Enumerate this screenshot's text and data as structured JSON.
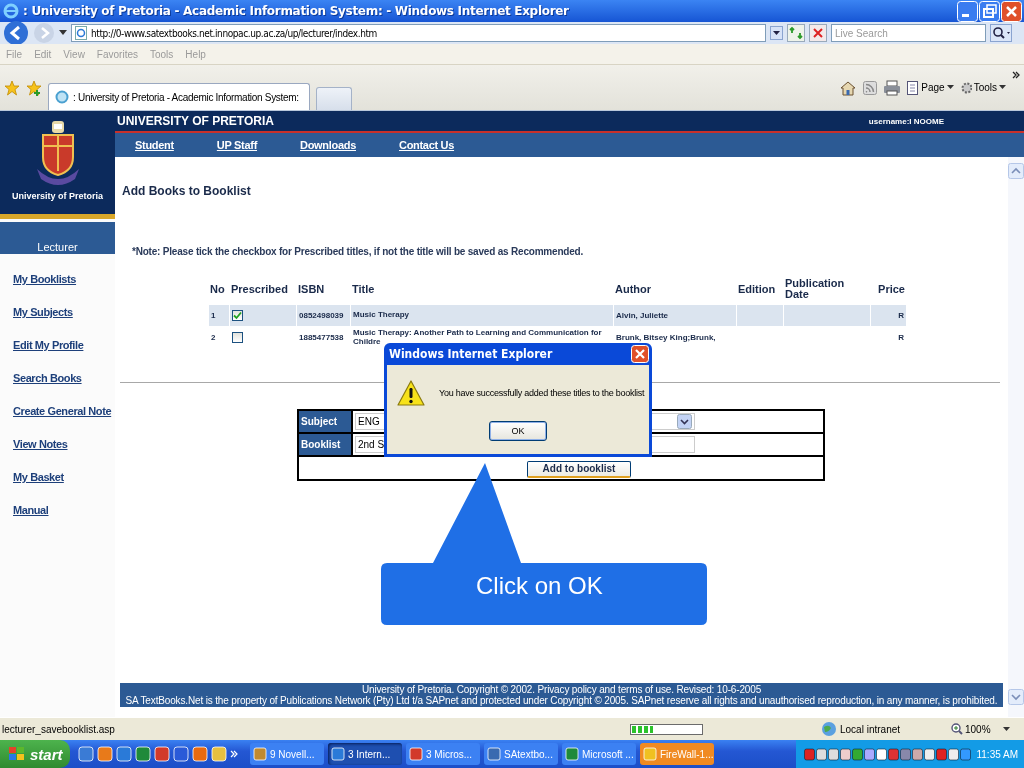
{
  "window": {
    "title": ": University of Pretoria - Academic Information System: - Windows Internet Explorer"
  },
  "address_bar": {
    "url": "http://0-www.satextbooks.net.innopac.up.ac.za/up/lecturer/index.htm",
    "search_placeholder": "Live Search"
  },
  "menu": [
    "File",
    "Edit",
    "View",
    "Favorites",
    "Tools",
    "Help"
  ],
  "tabs": [
    {
      "label": ": University of Pretoria - Academic Information System:",
      "selected": true
    }
  ],
  "command_bar": [
    "Page",
    "Tools"
  ],
  "site": {
    "banner": "UNIVERSITY OF PRETORIA",
    "user": "username:I NOOME",
    "logo_caption": "University of Pretoria",
    "nav": [
      "Student",
      "UP Staff",
      "Downloads",
      "Contact Us"
    ],
    "role": "Lecturer",
    "sidebar": [
      "My Booklists",
      "My Subjects",
      "Edit My Profile",
      "Search Books",
      "Create General Note",
      "View Notes",
      "My Basket",
      "Manual"
    ]
  },
  "page": {
    "heading": "Add Books to Booklist",
    "note": "*Note: Please tick the checkbox for Prescribed titles, if not the title will be saved as Recommended.",
    "table": {
      "columns": [
        "No",
        "Prescribed",
        "ISBN",
        "Title",
        "Author",
        "Edition",
        "Publication Date",
        "Price"
      ],
      "rows": [
        {
          "no": "1",
          "prescribed": true,
          "isbn": "0852498039",
          "title": "Music Therapy",
          "author": "Alvin, Juliette",
          "price": "R",
          "selected": true
        },
        {
          "no": "2",
          "prescribed": false,
          "isbn": "1885477538",
          "title": "Music Therapy: Another Path to Learning and Communication for Childre",
          "author": "Brunk, Bitsey King;Brunk,",
          "price": "R",
          "selected": false
        }
      ]
    },
    "form": {
      "fields": [
        {
          "label": "Subject",
          "value": "ENG",
          "kind": "select"
        },
        {
          "label": "Booklist",
          "value": "2nd S",
          "kind": "text"
        }
      ],
      "button": "Add to booklist"
    },
    "footer": [
      "University of Pretoria. Copyright © 2002. Privacy policy and terms of use. Revised: 10-6-2005",
      "SA TextBooks.Net is the property of Publications Network (Pty) Ltd t/a SAPnet and protected under Copyright © 2005. SAPnet reserve all rights and unauthorised reproduction, in any manner, is prohibited."
    ]
  },
  "dialog": {
    "title": "Windows Internet Explorer",
    "message": "You have successfully added these titles to the booklist",
    "button": "OK"
  },
  "callout": {
    "text": "Click on OK"
  },
  "status_bar": {
    "text": "lecturer_savebooklist.asp",
    "progress": {
      "level": 0.3
    },
    "zone": "Local intranet",
    "zoom": "100%"
  },
  "taskbar": {
    "start": "start",
    "tasks": [
      {
        "label": "9 Novell...",
        "selected": false,
        "flashing": false
      },
      {
        "label": "3 Intern...",
        "selected": true,
        "flashing": false
      },
      {
        "label": "3 Micros...",
        "selected": false,
        "flashing": false
      },
      {
        "label": "SAtextbo...",
        "selected": false,
        "flashing": false
      },
      {
        "label": "Microsoft ...",
        "selected": false,
        "flashing": false
      },
      {
        "label": "FireWall-1...",
        "selected": false,
        "flashing": true
      }
    ],
    "clock": "11:35 AM"
  }
}
